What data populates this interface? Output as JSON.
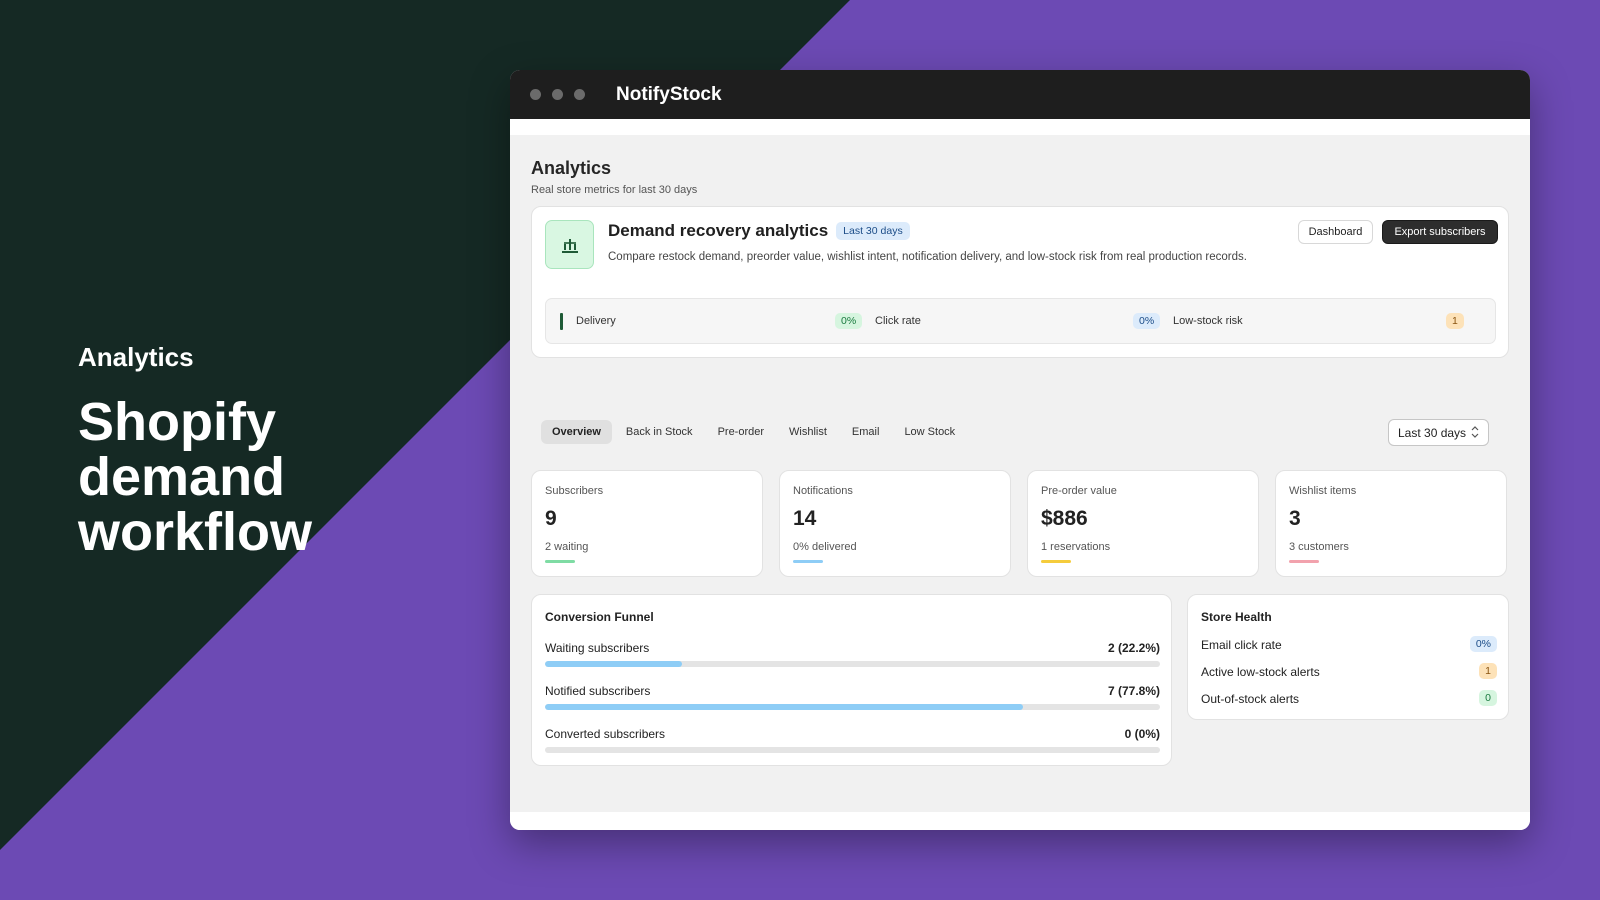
{
  "hero": {
    "kicker": "Analytics",
    "title": "Shopify\ndemand\nworkflow"
  },
  "app": {
    "title": "NotifyStock"
  },
  "page": {
    "title": "Analytics",
    "subtitle": "Real store metrics for last 30 days"
  },
  "summary": {
    "title": "Demand recovery analytics",
    "period_badge": "Last 30 days",
    "description": "Compare restock demand, preorder value, wishlist intent, notification delivery, and low-stock risk from real production records.",
    "dashboard_label": "Dashboard",
    "export_label": "Export subscribers",
    "stats": [
      {
        "label": "Delivery",
        "value": "0%"
      },
      {
        "label": "Click rate",
        "value": "0%"
      },
      {
        "label": "Low-stock risk",
        "value": "1"
      }
    ]
  },
  "tabs": [
    "Overview",
    "Back in Stock",
    "Pre-order",
    "Wishlist",
    "Email",
    "Low Stock"
  ],
  "range": {
    "selected": "Last 30 days"
  },
  "metrics": [
    {
      "label": "Subscribers",
      "value": "9",
      "sub": "2 waiting",
      "accent": "#7fdca4"
    },
    {
      "label": "Notifications",
      "value": "14",
      "sub": "0% delivered",
      "accent": "#8ecdf6"
    },
    {
      "label": "Pre-order value",
      "value": "$886",
      "sub": "1 reservations",
      "accent": "#f5cc3c"
    },
    {
      "label": "Wishlist items",
      "value": "3",
      "sub": "3 customers",
      "accent": "#f2a2ad"
    }
  ],
  "funnel": {
    "title": "Conversion Funnel",
    "rows": [
      {
        "label": "Waiting subscribers",
        "value": "2 (22.2%)",
        "percent": 22.2
      },
      {
        "label": "Notified subscribers",
        "value": "7 (77.8%)",
        "percent": 77.8
      },
      {
        "label": "Converted subscribers",
        "value": "0 (0%)",
        "percent": 0
      }
    ]
  },
  "health": {
    "title": "Store Health",
    "rows": [
      {
        "label": "Email click rate",
        "value": "0%",
        "tone": "blue"
      },
      {
        "label": "Active low-stock alerts",
        "value": "1",
        "tone": "orange"
      },
      {
        "label": "Out-of-stock alerts",
        "value": "0",
        "tone": "green"
      }
    ]
  },
  "colors": {
    "background_purple": "#6c4ab4",
    "background_dark": "#152924",
    "funnel_fill": "#8ecdf6"
  }
}
